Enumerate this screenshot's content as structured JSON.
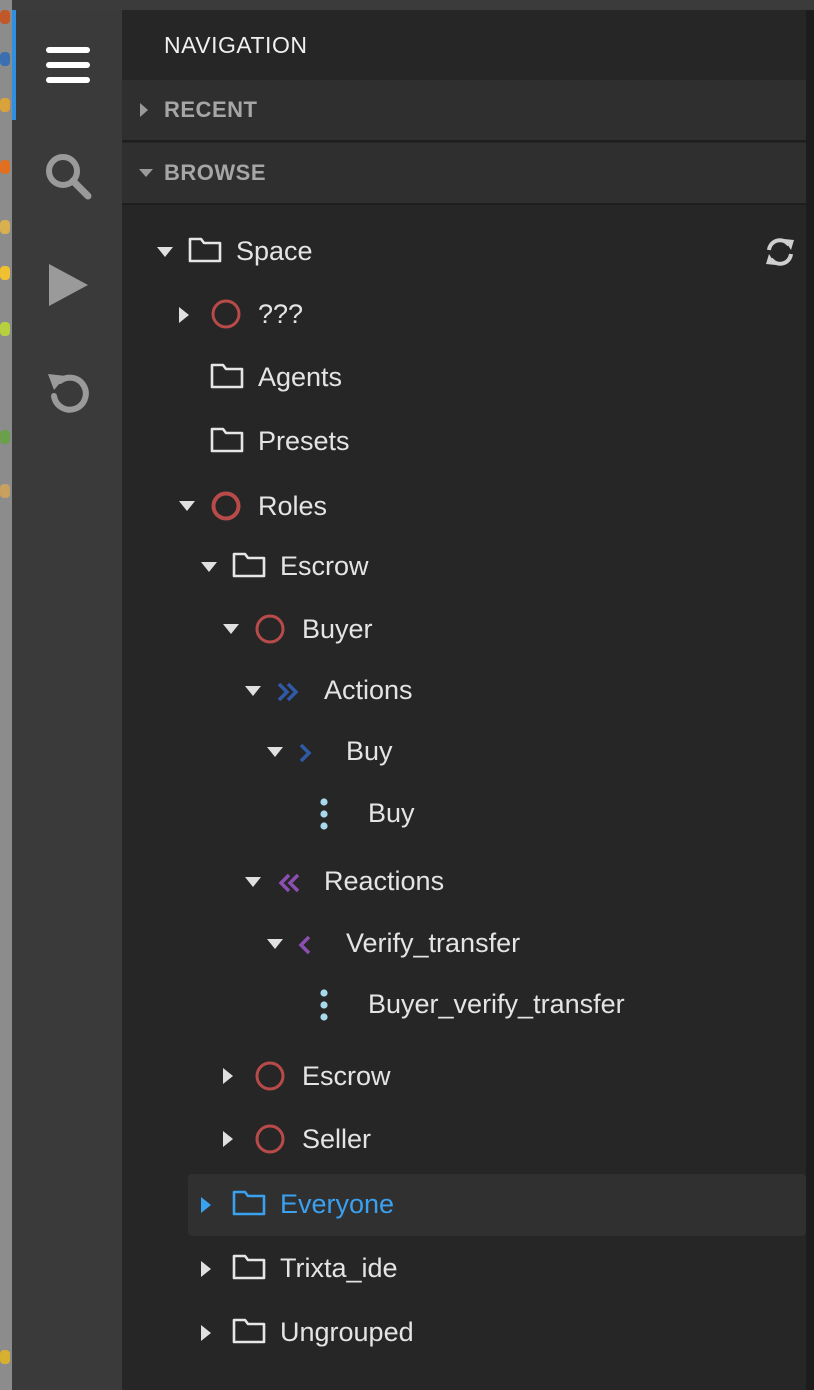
{
  "panel": {
    "title": "NAVIGATION",
    "sections": {
      "recent": "RECENT",
      "browse": "BROWSE"
    }
  },
  "rail": {
    "items": [
      "menu-icon",
      "search-icon",
      "play-icon",
      "undo-icon"
    ]
  },
  "colors": {
    "accent": "#3aa0f0",
    "role": "#b84a4a",
    "action": "#2f5aa8",
    "reaction": "#8a4fb0",
    "handler": "#a8d8ec"
  },
  "tree": {
    "space": "Space",
    "unknown": "???",
    "agents": "Agents",
    "presets": "Presets",
    "roles": "Roles",
    "escrow_group": "Escrow",
    "buyer": "Buyer",
    "actions": "Actions",
    "buy_action": "Buy",
    "buy_handler": "Buy",
    "reactions": "Reactions",
    "verify_transfer": "Verify_transfer",
    "buyer_verify_transfer": "Buyer_verify_transfer",
    "escrow_role": "Escrow",
    "seller": "Seller",
    "everyone": "Everyone",
    "trixta_ide": "Trixta_ide",
    "ungrouped": "Ungrouped"
  }
}
